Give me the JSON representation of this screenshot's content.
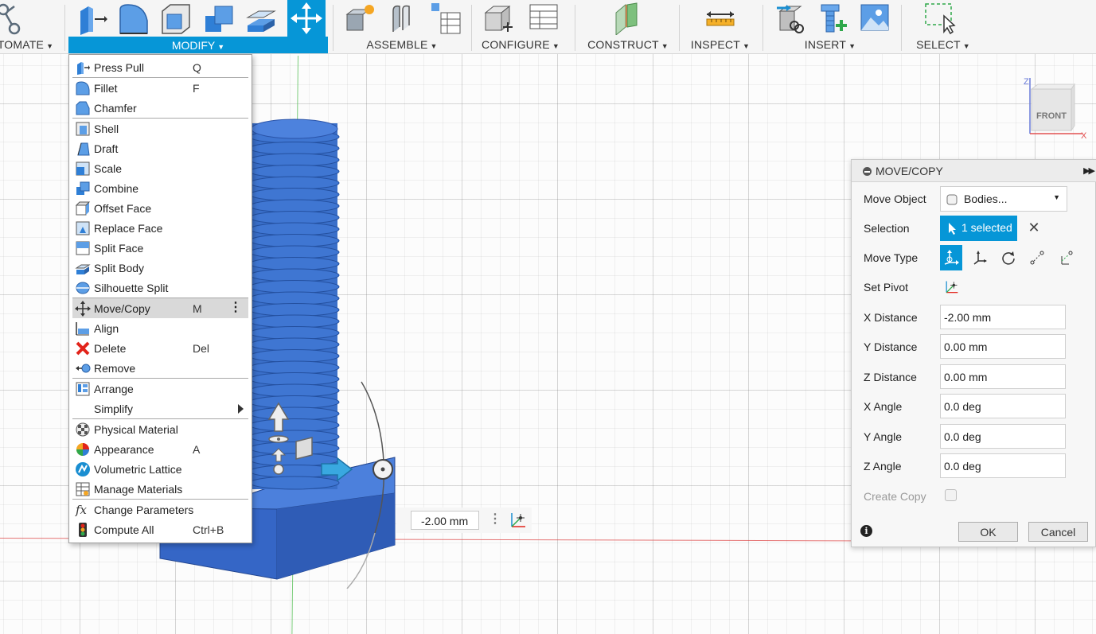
{
  "toolbar": {
    "groups": [
      {
        "label": "TOMATE"
      },
      {
        "label": "MODIFY"
      },
      {
        "label": "ASSEMBLE"
      },
      {
        "label": "CONFIGURE"
      },
      {
        "label": "CONSTRUCT"
      },
      {
        "label": "INSPECT"
      },
      {
        "label": "INSERT"
      },
      {
        "label": "SELECT"
      }
    ],
    "caret": "▼"
  },
  "modify_menu": {
    "items": [
      {
        "label": "Press Pull",
        "shortcut": "Q",
        "icon": "press-pull-icon"
      },
      {
        "label": "Fillet",
        "shortcut": "F",
        "icon": "fillet-icon"
      },
      {
        "label": "Chamfer",
        "shortcut": "",
        "icon": "chamfer-icon"
      },
      {
        "label": "Shell",
        "shortcut": "",
        "icon": "shell-icon"
      },
      {
        "label": "Draft",
        "shortcut": "",
        "icon": "draft-icon"
      },
      {
        "label": "Scale",
        "shortcut": "",
        "icon": "scale-icon"
      },
      {
        "label": "Combine",
        "shortcut": "",
        "icon": "combine-icon"
      },
      {
        "label": "Offset Face",
        "shortcut": "",
        "icon": "offset-face-icon"
      },
      {
        "label": "Replace Face",
        "shortcut": "",
        "icon": "replace-face-icon"
      },
      {
        "label": "Split Face",
        "shortcut": "",
        "icon": "split-face-icon"
      },
      {
        "label": "Split Body",
        "shortcut": "",
        "icon": "split-body-icon"
      },
      {
        "label": "Silhouette Split",
        "shortcut": "",
        "icon": "silhouette-split-icon"
      },
      {
        "label": "Move/Copy",
        "shortcut": "M",
        "icon": "move-copy-icon"
      },
      {
        "label": "Align",
        "shortcut": "",
        "icon": "align-icon"
      },
      {
        "label": "Delete",
        "shortcut": "Del",
        "icon": "delete-icon"
      },
      {
        "label": "Remove",
        "shortcut": "",
        "icon": "remove-icon"
      },
      {
        "label": "Arrange",
        "shortcut": "",
        "icon": "arrange-icon"
      },
      {
        "label": "Simplify",
        "shortcut": "",
        "icon": ""
      },
      {
        "label": "Physical Material",
        "shortcut": "",
        "icon": "physical-material-icon"
      },
      {
        "label": "Appearance",
        "shortcut": "A",
        "icon": "appearance-icon"
      },
      {
        "label": "Volumetric Lattice",
        "shortcut": "",
        "icon": "volumetric-lattice-icon"
      },
      {
        "label": "Manage Materials",
        "shortcut": "",
        "icon": "manage-materials-icon"
      },
      {
        "label": "Change Parameters",
        "shortcut": "",
        "icon": "fx-icon"
      },
      {
        "label": "Compute All",
        "shortcut": "Ctrl+B",
        "icon": "compute-all-icon"
      }
    ],
    "more": "⋮"
  },
  "viewcube": {
    "face": "FRONT",
    "axis_z": "Z",
    "axis_x": "X"
  },
  "distance_manipulator": {
    "value": "-2.00 mm",
    "more": "⋮"
  },
  "move_copy_panel": {
    "title": "MOVE/COPY",
    "expand": "▶▶",
    "move_object": {
      "label": "Move Object",
      "value": "Bodies..."
    },
    "selection": {
      "label": "Selection",
      "value": "1 selected",
      "clear": "✕"
    },
    "move_type": {
      "label": "Move Type",
      "options": [
        "free-move",
        "translate",
        "rotate",
        "point-to-point",
        "point-to-position"
      ],
      "active": "free-move"
    },
    "set_pivot": {
      "label": "Set Pivot"
    },
    "x_distance": {
      "label": "X Distance",
      "value": "-2.00 mm"
    },
    "y_distance": {
      "label": "Y Distance",
      "value": "0.00 mm"
    },
    "z_distance": {
      "label": "Z Distance",
      "value": "0.00 mm"
    },
    "x_angle": {
      "label": "X Angle",
      "value": "0.0 deg"
    },
    "y_angle": {
      "label": "Y Angle",
      "value": "0.0 deg"
    },
    "z_angle": {
      "label": "Z Angle",
      "value": "0.0 deg"
    },
    "create_copy": {
      "label": "Create Copy",
      "checked": false
    },
    "info": "i",
    "ok": "OK",
    "cancel": "Cancel"
  },
  "colors": {
    "accent": "#0696d7",
    "body": "#3a6fc9"
  }
}
